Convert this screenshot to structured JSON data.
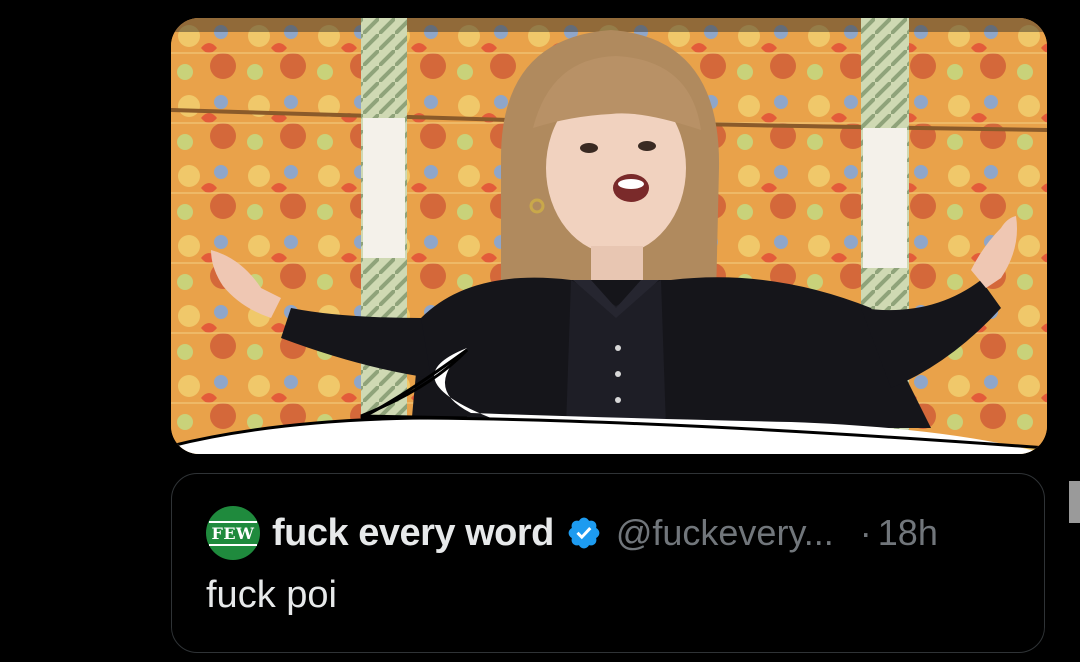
{
  "media": {
    "alt": "Photo with speech bubble"
  },
  "quote": {
    "avatar_text": "FEW",
    "display_name": "fuck every word",
    "handle": "@fuckevery...",
    "separator": "·",
    "time": "18h",
    "text": "fuck poi"
  },
  "colors": {
    "background": "#000000",
    "text_primary": "#e7e9ea",
    "text_secondary": "#71767b",
    "verified": "#1d9bf0",
    "avatar": "#1f8a3d"
  },
  "icons": {
    "verified": "verified-badge-icon"
  }
}
